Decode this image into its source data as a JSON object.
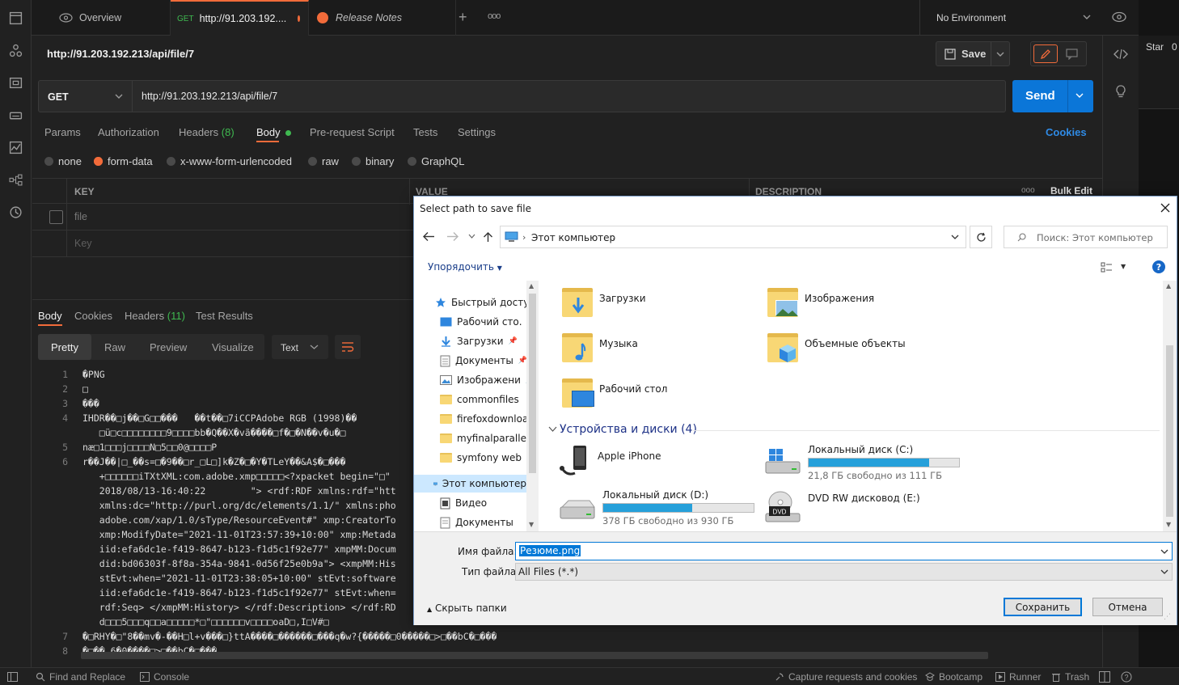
{
  "tabs": {
    "overview": "Overview",
    "request_method": "GET",
    "request_title": "http://91.203.192....",
    "release_notes": "Release Notes",
    "add": "+",
    "more": "ooo"
  },
  "environment": {
    "selected": "No Environment"
  },
  "request": {
    "name": "http://91.203.192.213/api/file/7",
    "save_label": "Save",
    "method": "GET",
    "url": "http://91.203.192.213/api/file/7",
    "send_label": "Send",
    "cookies_link": "Cookies"
  },
  "request_tabs": {
    "params": "Params",
    "authorization": "Authorization",
    "headers": "Headers",
    "headers_count": "(8)",
    "body": "Body",
    "pre_request": "Pre-request Script",
    "tests": "Tests",
    "settings": "Settings"
  },
  "body_types": {
    "none": "none",
    "form_data": "form-data",
    "urlencoded": "x-www-form-urlencoded",
    "raw": "raw",
    "binary": "binary",
    "graphql": "GraphQL"
  },
  "form_table": {
    "key_header": "KEY",
    "value_header": "VALUE",
    "description_header": "DESCRIPTION",
    "more": "ooo",
    "bulk_edit": "Bulk Edit",
    "row1_key": "file",
    "placeholder_key": "Key"
  },
  "response_tabs": {
    "body": "Body",
    "cookies": "Cookies",
    "headers": "Headers",
    "headers_count": "(11)",
    "test_results": "Test Results"
  },
  "response_view": {
    "pretty": "Pretty",
    "raw": "Raw",
    "preview": "Preview",
    "visualize": "Visualize",
    "format": "Text"
  },
  "code_lines": [
    {
      "n": "1",
      "text": "�PNG"
    },
    {
      "n": "2",
      "text": "□"
    },
    {
      "n": "3",
      "text": "���"
    },
    {
      "n": "4",
      "text": "IHDR��□j��□G□□���   ��t��□7iCCPAdobe RGB (1998)��"
    },
    {
      "n": "",
      "text": "   □ü□c□□□□□□□□9□□□□bb�Q��X�vã����□f�□�N��v�u�□"
    },
    {
      "n": "5",
      "text": "næ□1□□□j□□□□N□5□□0@□□□□P"
    },
    {
      "n": "6",
      "text": "r��J��|□_��s=□�9��□r_□L□]k�Z�□�Y�TLeY��&A$�□���"
    },
    {
      "n": "",
      "text": "   +□□□□□□iTXtXML:com.adobe.xmp□□□□□<?xpacket begin=\"□\""
    },
    {
      "n": "",
      "text": "   2018/08/13-16:40:22        \"> <rdf:RDF xmlns:rdf=\"htt"
    },
    {
      "n": "",
      "text": "   xmlns:dc=\"http://purl.org/dc/elements/1.1/\" xmlns:pho"
    },
    {
      "n": "",
      "text": "   adobe.com/xap/1.0/sType/ResourceEvent#\" xmp:CreatorTo"
    },
    {
      "n": "",
      "text": "   xmp:ModifyDate=\"2021-11-01T23:57:39+10:00\" xmp:Metada"
    },
    {
      "n": "",
      "text": "   iid:efa6dc1e-f419-8647-b123-f1d5c1f92e77\" xmpMM:Docum"
    },
    {
      "n": "",
      "text": "   did:bd06303f-8f8a-354a-9841-0d56f25e0b9a\"> <xmpMM:His"
    },
    {
      "n": "",
      "text": "   stEvt:when=\"2021-11-01T23:38:05+10:00\" stEvt:software"
    },
    {
      "n": "",
      "text": "   iid:efa6dc1e-f419-8647-b123-f1d5c1f92e77\" stEvt:when="
    },
    {
      "n": "",
      "text": "   rdf:Seq> </xmpMM:History> </rdf:Description> </rdf:RD"
    },
    {
      "n": "",
      "text": "   d□□□5□□□q□□a□□□□□*□\"□□□□□□v□□□□oaD□,I□V#□"
    },
    {
      "n": "7",
      "text": "�□RHY�□\"8��mv�-��H□l+v���□}ttA����□������□���q�w?{�����□0�����□>□��bC�□���"
    },
    {
      "n": "8",
      "text": "�□�� 6�0����□>□��bC�□���"
    }
  ],
  "statusbar": {
    "find_replace": "Find and Replace",
    "console": "Console",
    "capture": "Capture requests and cookies",
    "bootcamp": "Bootcamp",
    "runner": "Runner",
    "trash": "Trash"
  },
  "far_right": {
    "star": "Star",
    "count": "0"
  },
  "dialog": {
    "title": "Select path to save file",
    "breadcrumb": "Этот компьютер",
    "search_placeholder": "Поиск: Этот компьютер",
    "organize": "Упорядочить",
    "nav": [
      {
        "label": "Быстрый доступ"
      },
      {
        "label": "Рабочий сто."
      },
      {
        "label": "Загрузки"
      },
      {
        "label": "Документы"
      },
      {
        "label": "Изображени"
      },
      {
        "label": "commonfiles"
      },
      {
        "label": "firefoxdownload"
      },
      {
        "label": "myfinalparallelp"
      },
      {
        "label": "symfony web"
      },
      {
        "label": "Этот компьютер"
      },
      {
        "label": "Видео"
      },
      {
        "label": "Документы"
      }
    ],
    "folders": [
      {
        "label": "Загрузки"
      },
      {
        "label": "Изображения"
      },
      {
        "label": "Музыка"
      },
      {
        "label": "Объемные объекты"
      },
      {
        "label": "Рабочий стол"
      }
    ],
    "devices_header": "Устройства и диски (4)",
    "devices": [
      {
        "label": "Apple iPhone"
      },
      {
        "label": "Локальный диск (C:)",
        "free": "21,8 ГБ свободно из 111 ГБ",
        "used_fraction": 0.8
      },
      {
        "label": "Локальный диск (D:)",
        "free": "378 ГБ свободно из 930 ГБ",
        "used_fraction": 0.59
      },
      {
        "label": "DVD RW дисковод (E:)",
        "badge": "DVD"
      }
    ],
    "filename_label": "Имя файла:",
    "filename_value": "Резюме.png",
    "filetype_label": "Тип файла:",
    "filetype_value": "All Files (*.*)",
    "hide_folders": "Скрыть папки",
    "save_button": "Сохранить",
    "cancel_button": "Отмена"
  }
}
